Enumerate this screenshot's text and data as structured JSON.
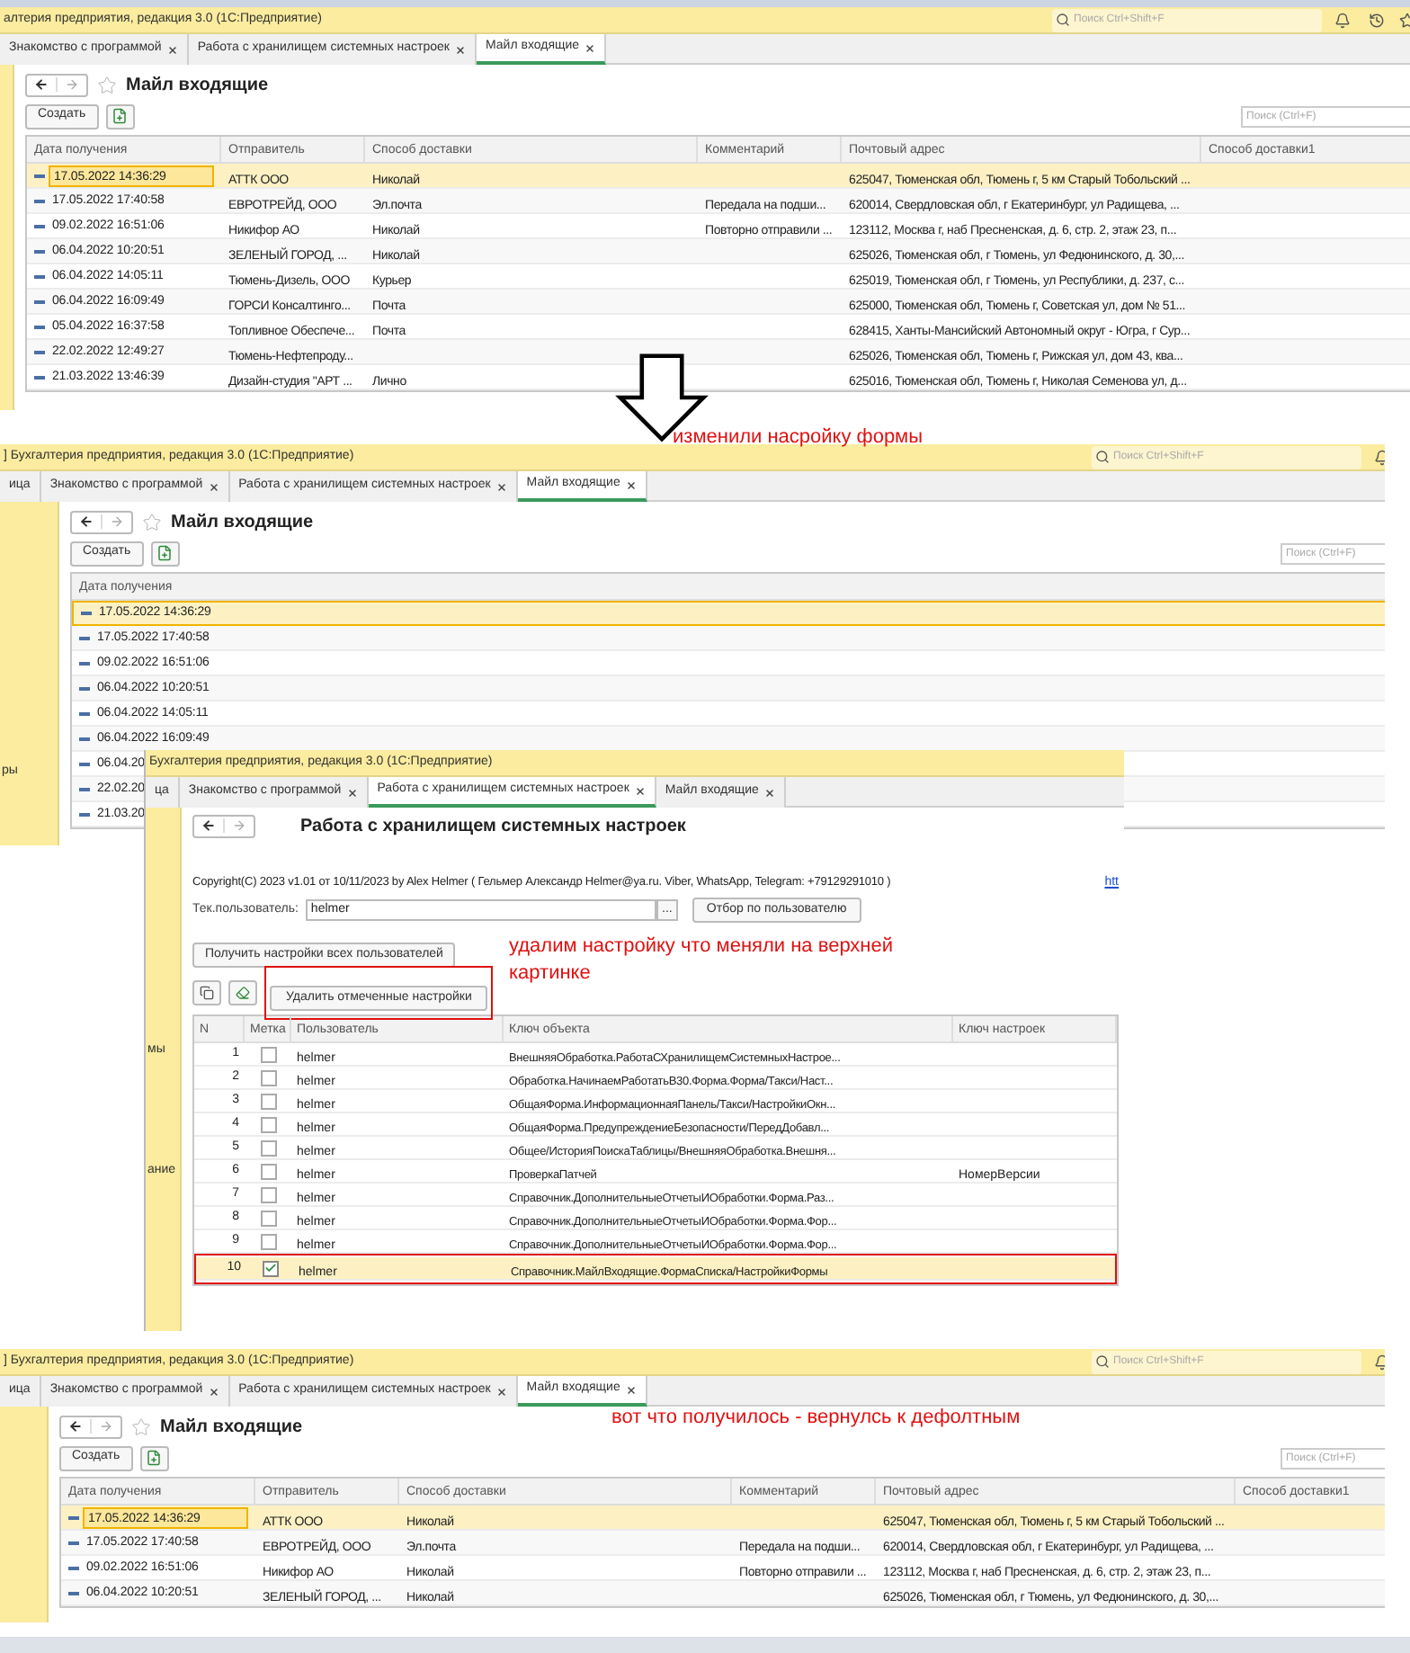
{
  "windows": [
    {
      "kind": "list",
      "title": "алтерия предприятия, редакция 3.0  (1С:Предприятие)",
      "search_placeholder": "Поиск Ctrl+Shift+F",
      "tabs": [
        {
          "label": "Знакомство с программой",
          "selected": false
        },
        {
          "label": "Работа с хранилищем системных настроек",
          "selected": false
        },
        {
          "label": "Майл входящие",
          "selected": true
        }
      ],
      "form": {
        "title": "Майл входящие",
        "create_button": "Создать",
        "search_placeholder": "Поиск (Ctrl+F)",
        "columns": [
          "Дата получения",
          "Отправитель",
          "Способ доставки",
          "Комментарий",
          "Почтовый адрес",
          "Способ доставки1"
        ],
        "rows": [
          {
            "date": "17.05.2022 14:36:29",
            "sender": "АТТК ООО",
            "delivery": "Николай",
            "address": "625047, Тюменская обл, Тюмень г, 5 км Старый Тобольский ...",
            "selected": true
          },
          {
            "date": "17.05.2022 17:40:58",
            "sender": "ЕВРОТРЕЙД, ООО",
            "delivery": "Эл.почта",
            "comment": "Передала на подши...",
            "address": "620014, Свердловская обл, г Екатеринбург, ул Радищева, ...",
            "selected": false
          },
          {
            "date": "09.02.2022 16:51:06",
            "sender": "Никифор АО",
            "delivery": "Николай",
            "comment": "Повторно отправили ...",
            "address": "123112, Москва г, наб Пресненская, д. 6, стр. 2, этаж 23, п...",
            "selected": false
          },
          {
            "date": "06.04.2022 10:20:51",
            "sender": "ЗЕЛЕНЫЙ ГОРОД, ...",
            "delivery": "Николай",
            "address": "625026, Тюменская обл, г Тюмень, ул Федюнинского, д. 30,...",
            "selected": false
          },
          {
            "date": "06.04.2022 14:05:11",
            "sender": "Тюмень-Дизель, ООО",
            "delivery": "Курьер",
            "address": "625019, Тюменская обл, г Тюмень, ул Республики, д. 237, с...",
            "selected": false
          },
          {
            "date": "06.04.2022 16:09:49",
            "sender": "ГОРСИ Консалтинго...",
            "delivery": "Почта",
            "address": "625000, Тюменская обл, Тюмень г, Советская ул, дом № 51...",
            "selected": false
          },
          {
            "date": "05.04.2022 16:37:58",
            "sender": "Топливное Обеспече...",
            "delivery": "Почта",
            "address": "628415, Ханты-Мансийский Автономный округ - Югра, г Сур...",
            "selected": false
          },
          {
            "date": "22.02.2022 12:49:27",
            "sender": "Тюмень-Нефтепроду...",
            "address": "625026, Тюменская обл, Тюмень г, Рижская ул, дом 43, ква...",
            "selected": false
          },
          {
            "date": "21.03.2022 13:46:39",
            "sender": "Дизайн-студия \"АРТ ...",
            "delivery": "Лично",
            "address": "625016, Тюменская обл, Тюмень г, Николая Семенова ул, д...",
            "selected": false
          }
        ]
      }
    },
    {
      "kind": "list",
      "title": "] Бухгалтерия предприятия, редакция 3.0  (1С:Предприятие)",
      "search_placeholder": "Поиск Ctrl+Shift+F",
      "note": "изменили насройку формы",
      "tabs": [
        {
          "label": "ица",
          "selected": false
        },
        {
          "label": "Знакомство с программой",
          "selected": false
        },
        {
          "label": "Работа с хранилищем системных настроек",
          "selected": false
        },
        {
          "label": "Майл входящие",
          "selected": true
        }
      ],
      "sidebar_fragments": [
        "ры"
      ],
      "form": {
        "title": "Майл входящие",
        "create_button": "Создать",
        "search_placeholder": "Поиск (Ctrl+F)",
        "columns": [
          "Дата получения"
        ],
        "rows": [
          {
            "date": "17.05.2022 14:36:29",
            "selected": true
          },
          {
            "date": "17.05.2022 17:40:58",
            "selected": false
          },
          {
            "date": "09.02.2022 16:51:06",
            "selected": false
          },
          {
            "date": "06.04.2022 10:20:51",
            "selected": false
          },
          {
            "date": "06.04.2022 14:05:11",
            "selected": false
          },
          {
            "date": "06.04.2022 16:09:49",
            "selected": false
          },
          {
            "date": "06.04.20",
            "selected": false
          },
          {
            "date": "22.02.20",
            "selected": false
          },
          {
            "date": "21.03.20",
            "selected": false
          }
        ]
      }
    },
    {
      "kind": "settings",
      "title": "Бухгалтерия предприятия, редакция 3.0  (1С:Предприятие)",
      "note": "удалим настройку что меняли на верхней картинке",
      "tabs": [
        {
          "label": "ца",
          "selected": false
        },
        {
          "label": "Знакомство с программой",
          "selected": false
        },
        {
          "label": "Работа с хранилищем системных настроек",
          "selected": true
        },
        {
          "label": "Майл входящие",
          "selected": false
        }
      ],
      "sidebar_fragments": [
        "мы",
        "ание"
      ],
      "form": {
        "title": "Работа с хранилищем системных настроек",
        "copyright": "Copyright(C)  2023 v1.01 от 10/11/2023  by Alex Helmer ( Гельмер Александр Helmer@ya.ru. Viber, WhatsApp, Telegram: +79129291010 )",
        "link": "htt",
        "user_label": "Тек.пользователь:",
        "user_value": "helmer",
        "choose_button": "...",
        "filter_button": "Отбор по пользователю",
        "get_all_button": "Получить настройки всех пользователей",
        "delete_button": {
          "label": "Удалить отмеченные настройки",
          "highlighted": true
        },
        "columns": [
          "N",
          "Метка",
          "Пользователь",
          "Ключ объекта",
          "Ключ настроек"
        ],
        "rows": [
          {
            "n": "1",
            "checked": false,
            "user": "helmer",
            "object_key": "ВнешняяОбработка.РаботаСХранилищемСистемныхНастрое...",
            "selected": false,
            "highlighted": false
          },
          {
            "n": "2",
            "checked": false,
            "user": "helmer",
            "object_key": "Обработка.НачинаемРаботатьВ30.Форма.Форма/Такси/Наст...",
            "selected": false,
            "highlighted": false
          },
          {
            "n": "3",
            "checked": false,
            "user": "helmer",
            "object_key": "ОбщаяФорма.ИнформационнаяПанель/Такси/НастройкиОкн...",
            "selected": false,
            "highlighted": false
          },
          {
            "n": "4",
            "checked": false,
            "user": "helmer",
            "object_key": "ОбщаяФорма.ПредупреждениеБезопасности/ПередДобавл...",
            "selected": false,
            "highlighted": false
          },
          {
            "n": "5",
            "checked": false,
            "user": "helmer",
            "object_key": "Общее/ИсторияПоискаТаблицы/ВнешняяОбработка.Внешня...",
            "selected": false,
            "highlighted": false
          },
          {
            "n": "6",
            "checked": false,
            "user": "helmer",
            "object_key": "ПроверкаПатчей",
            "settings_key": "НомерВерсии",
            "selected": false,
            "highlighted": false
          },
          {
            "n": "7",
            "checked": false,
            "user": "helmer",
            "object_key": "Справочник.ДополнительныеОтчетыИОбработки.Форма.Раз...",
            "selected": false,
            "highlighted": false
          },
          {
            "n": "8",
            "checked": false,
            "user": "helmer",
            "object_key": "Справочник.ДополнительныеОтчетыИОбработки.Форма.Фор...",
            "selected": false,
            "highlighted": false
          },
          {
            "n": "9",
            "checked": false,
            "user": "helmer",
            "object_key": "Справочник.ДополнительныеОтчетыИОбработки.Форма.Фор...",
            "selected": false,
            "highlighted": false
          },
          {
            "n": "10",
            "checked": true,
            "user": "helmer",
            "object_key": "Справочник.МайлВходящие.ФормаСписка/НастройкиФормы",
            "selected": true,
            "highlighted": true
          }
        ]
      }
    },
    {
      "kind": "list",
      "title": "] Бухгалтерия предприятия, редакция 3.0  (1С:Предприятие)",
      "search_placeholder": "Поиск Ctrl+Shift+F",
      "note": "вот что получилось - вернулсь к дефолтным",
      "tabs": [
        {
          "label": "ица",
          "selected": false
        },
        {
          "label": "Знакомство с программой",
          "selected": false
        },
        {
          "label": "Работа с хранилищем системных настроек",
          "selected": false
        },
        {
          "label": "Майл входящие",
          "selected": true
        }
      ],
      "form": {
        "title": "Майл входящие",
        "create_button": "Создать",
        "search_placeholder": "Поиск (Ctrl+F)",
        "columns": [
          "Дата получения",
          "Отправитель",
          "Способ доставки",
          "Комментарий",
          "Почтовый адрес",
          "Способ доставки1"
        ],
        "rows": [
          {
            "date": "17.05.2022 14:36:29",
            "sender": "АТТК ООО",
            "delivery": "Николай",
            "address": "625047, Тюменская обл, Тюмень г, 5 км Старый Тобольский ...",
            "selected": true
          },
          {
            "date": "17.05.2022 17:40:58",
            "sender": "ЕВРОТРЕЙД, ООО",
            "delivery": "Эл.почта",
            "comment": "Передала на подши...",
            "address": "620014, Свердловская обл, г Екатеринбург, ул Радищева, ...",
            "selected": false
          },
          {
            "date": "09.02.2022 16:51:06",
            "sender": "Никифор АО",
            "delivery": "Николай",
            "comment": "Повторно отправили ...",
            "address": "123112, Москва г, наб Пресненская, д. 6, стр. 2, этаж 23, п...",
            "selected": false
          },
          {
            "date": "06.04.2022 10:20:51",
            "sender": "ЗЕЛЕНЫЙ ГОРОД, ...",
            "delivery": "Николай",
            "address": "625026, Тюменская обл, г Тюмень, ул Федюнинского, д. 30,...",
            "selected": false
          }
        ]
      }
    }
  ]
}
